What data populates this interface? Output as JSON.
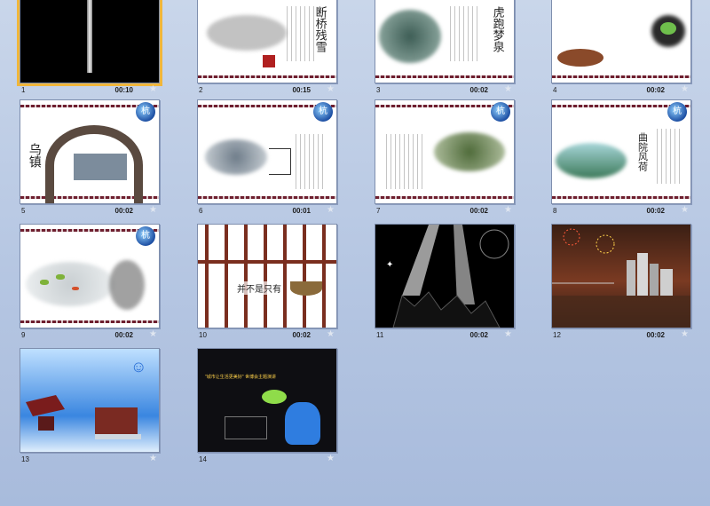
{
  "slides": [
    {
      "number": "1",
      "time": "00:10",
      "icon": "transition-star-icon"
    },
    {
      "number": "2",
      "time": "00:15",
      "icon": "transition-star-icon",
      "title": "断桥残雪"
    },
    {
      "number": "3",
      "time": "00:02",
      "icon": "transition-star-icon",
      "title": "虎跑梦泉"
    },
    {
      "number": "4",
      "time": "00:02",
      "icon": "transition-star-icon"
    },
    {
      "number": "5",
      "time": "00:02",
      "icon": "transition-star-icon",
      "title": "乌镇"
    },
    {
      "number": "6",
      "time": "00:01",
      "icon": "transition-star-icon"
    },
    {
      "number": "7",
      "time": "00:02",
      "icon": "transition-star-icon"
    },
    {
      "number": "8",
      "time": "00:02",
      "icon": "transition-star-icon",
      "title": "曲院风荷"
    },
    {
      "number": "9",
      "time": "00:02",
      "icon": "transition-star-icon"
    },
    {
      "number": "10",
      "time": "00:02",
      "icon": "transition-star-icon",
      "caption": "并不是只有"
    },
    {
      "number": "11",
      "time": "00:02",
      "icon": "transition-star-icon"
    },
    {
      "number": "12",
      "time": "00:02",
      "icon": "transition-star-icon"
    },
    {
      "number": "13",
      "time": "",
      "icon": "transition-star-icon"
    },
    {
      "number": "14",
      "time": "",
      "icon": "transition-star-icon",
      "title": "\"城市让生活更美好\" 世博会主题演讲"
    }
  ],
  "colors": {
    "selected_outline": "#f0b63a",
    "background": "#b5c6e2"
  },
  "logo_glyph": "杭"
}
